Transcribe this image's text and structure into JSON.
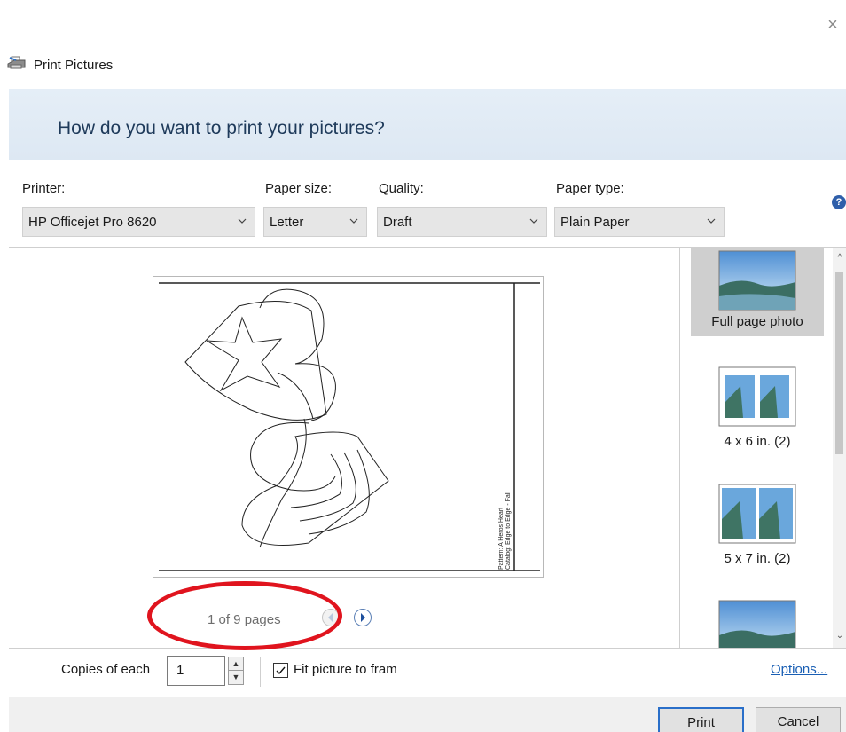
{
  "window": {
    "title": "Print Pictures",
    "heading": "How do you want to print your pictures?",
    "close_glyph": "×"
  },
  "settings": {
    "printer_label": "Printer:",
    "printer_value": "HP Officejet Pro 8620",
    "paper_size_label": "Paper size:",
    "paper_size_value": "Letter",
    "quality_label": "Quality:",
    "quality_value": "Draft",
    "paper_type_label": "Paper type:",
    "paper_type_value": "Plain Paper",
    "help_glyph": "?"
  },
  "preview": {
    "page_text_line1": "Pattern: A Heros Heart",
    "page_text_line2": "Catalog:   Edge to Edge - Fall",
    "page_count": "1 of 9 pages"
  },
  "layouts": [
    {
      "label": "Full page photo",
      "selected": true
    },
    {
      "label": "4 x 6 in. (2)",
      "selected": false
    },
    {
      "label": "5 x 7 in. (2)",
      "selected": false
    }
  ],
  "bottom": {
    "copies_label": "Copies of each",
    "copies_value": "1",
    "fit_label": "Fit picture to fram",
    "fit_checked": true,
    "options_label": "Options..."
  },
  "buttons": {
    "print": "Print",
    "cancel": "Cancel"
  },
  "colors": {
    "accent": "#2a6fc9",
    "link": "#1a5fb4",
    "annotation": "#e0141e"
  }
}
